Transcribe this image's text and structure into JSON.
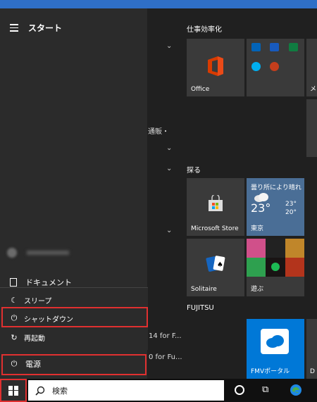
{
  "start_menu": {
    "title": "スタート",
    "documents_label": "ドキュメント"
  },
  "app_list_fragments": {
    "frag1": "通販・",
    "frag2": "14 for F...",
    "frag3": "0 for Fu..."
  },
  "power_menu": {
    "items": [
      {
        "label": "スリープ",
        "icon": "moon-icon"
      },
      {
        "label": "シャットダウン",
        "icon": "power-icon"
      },
      {
        "label": "再起動",
        "icon": "restart-icon"
      }
    ],
    "power_label": "電源"
  },
  "tile_groups": {
    "group1": "仕事効率化",
    "group2": "探る",
    "group3": "FUJITSU"
  },
  "tiles": {
    "office": "Office",
    "mail_partial": "メ",
    "store": "Microsoft Store",
    "weather_title": "曇り所により晴れ",
    "weather_temp": "23°",
    "weather_high": "23°",
    "weather_low": "20°",
    "weather_city": "東京",
    "solitaire": "Solitaire",
    "play": "遊ぶ",
    "fmv": "FMVポータル",
    "partial_d": "D"
  },
  "taskbar": {
    "search_label": "検索"
  },
  "colors": {
    "highlight": "#e03030",
    "tile_blue": "#0078d7",
    "tile_gray": "#3a3a3a"
  }
}
